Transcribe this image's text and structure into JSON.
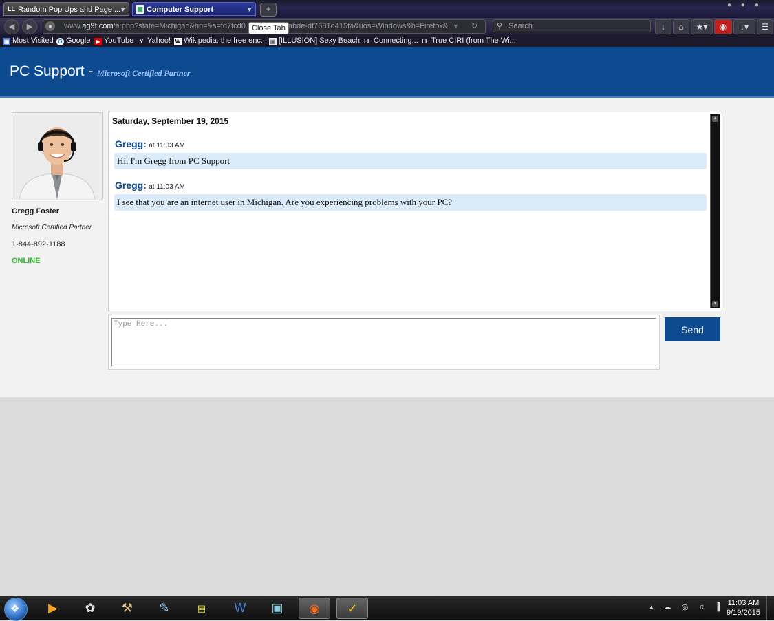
{
  "browser": {
    "tabs": [
      {
        "title": "Random Pop Ups and Page ...",
        "icon": "LL"
      },
      {
        "title": "Computer Support",
        "icon": "▣"
      }
    ],
    "new_tab_symbol": "+",
    "tooltip": "Close Tab",
    "url": {
      "prefix": "www.",
      "domain": "ag9f.com",
      "path": "/e.php?state=Michigan&hn=&s=fd7fcd0",
      "tail": "abde-df7681d415fa&uos=Windows&b=Firefox&"
    },
    "search_placeholder": "Search",
    "bookmarks": [
      {
        "label": "Most Visited",
        "icon": "▣"
      },
      {
        "label": "Google",
        "icon": "G"
      },
      {
        "label": "YouTube",
        "icon": "▶"
      },
      {
        "label": "Yahoo!",
        "icon": "Y"
      },
      {
        "label": "Wikipedia, the free enc...",
        "icon": "W"
      },
      {
        "label": "[ILLUSION] Sexy Beach ...",
        "icon": "▣"
      },
      {
        "label": "Connecting...",
        "icon": "LL"
      },
      {
        "label": "True CIRI (from The Wi...",
        "icon": "LL"
      }
    ]
  },
  "page": {
    "brand": "PC Support - ",
    "brand_sub": "Microsoft Certified Partner",
    "agent": {
      "name": "Gregg Foster",
      "title": "Microsoft Certified Partner",
      "phone": "1-844-892-1188",
      "status": "ONLINE"
    },
    "chat": {
      "date": "Saturday, September 19, 2015",
      "messages": [
        {
          "sender": "Gregg:",
          "time": "at 11:03 AM",
          "text": "Hi, I'm Gregg from PC Support"
        },
        {
          "sender": "Gregg:",
          "time": "at 11:03 AM",
          "text": "I see that you are an internet user in Michigan. Are you experiencing problems with your PC?"
        }
      ]
    },
    "input_placeholder": "Type Here...",
    "send_label": "Send"
  },
  "taskbar": {
    "time": "11:03 AM",
    "date": "9/19/2015",
    "tray": "▴ ☁ ◎ ♫ ▐"
  }
}
